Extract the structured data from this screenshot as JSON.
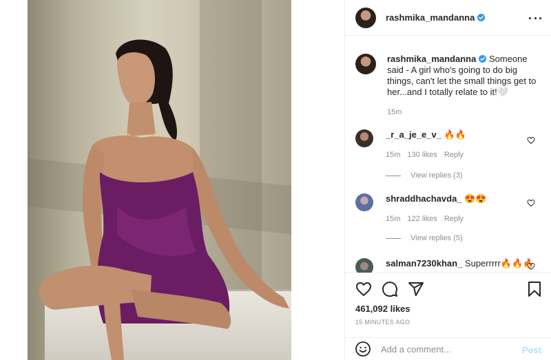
{
  "post": {
    "username": "rashmika_mandanna",
    "verified": true,
    "more_icon": "more-horizontal-icon",
    "photo_alt_icon": "photo-image"
  },
  "caption": {
    "username": "rashmika_mandanna",
    "text": "Someone said - A girl who's going to do big things, can't let the small things get to her...and I totally relate to it!🤍",
    "time": "15m"
  },
  "comments": [
    {
      "username": "_r_a_je_e_v_",
      "text": "🔥🔥",
      "time": "15m",
      "likes": "130 likes",
      "reply": "Reply",
      "view_replies": "View replies (3)"
    },
    {
      "username": "shraddhachavda_",
      "text": "😍😍",
      "time": "15m",
      "likes": "122 likes",
      "reply": "Reply",
      "view_replies": "View replies (5)"
    },
    {
      "username": "salman7230khan_",
      "text": "Superrrrr🔥🔥🔥"
    }
  ],
  "actions": {
    "like_icon": "heart-icon",
    "comment_icon": "comment-icon",
    "share_icon": "share-icon",
    "save_icon": "bookmark-icon"
  },
  "likes": "461,092 likes",
  "posted_ago": "15 MINUTES AGO",
  "add_comment": {
    "placeholder": "Add a comment...",
    "post_label": "Post",
    "emoji_icon": "emoji-icon"
  },
  "colors": {
    "verified_blue": "#3897f0",
    "post_disabled": "#b2dffc",
    "secondary_text": "#8e8e8e",
    "dress_purple": "#6a1d63"
  }
}
